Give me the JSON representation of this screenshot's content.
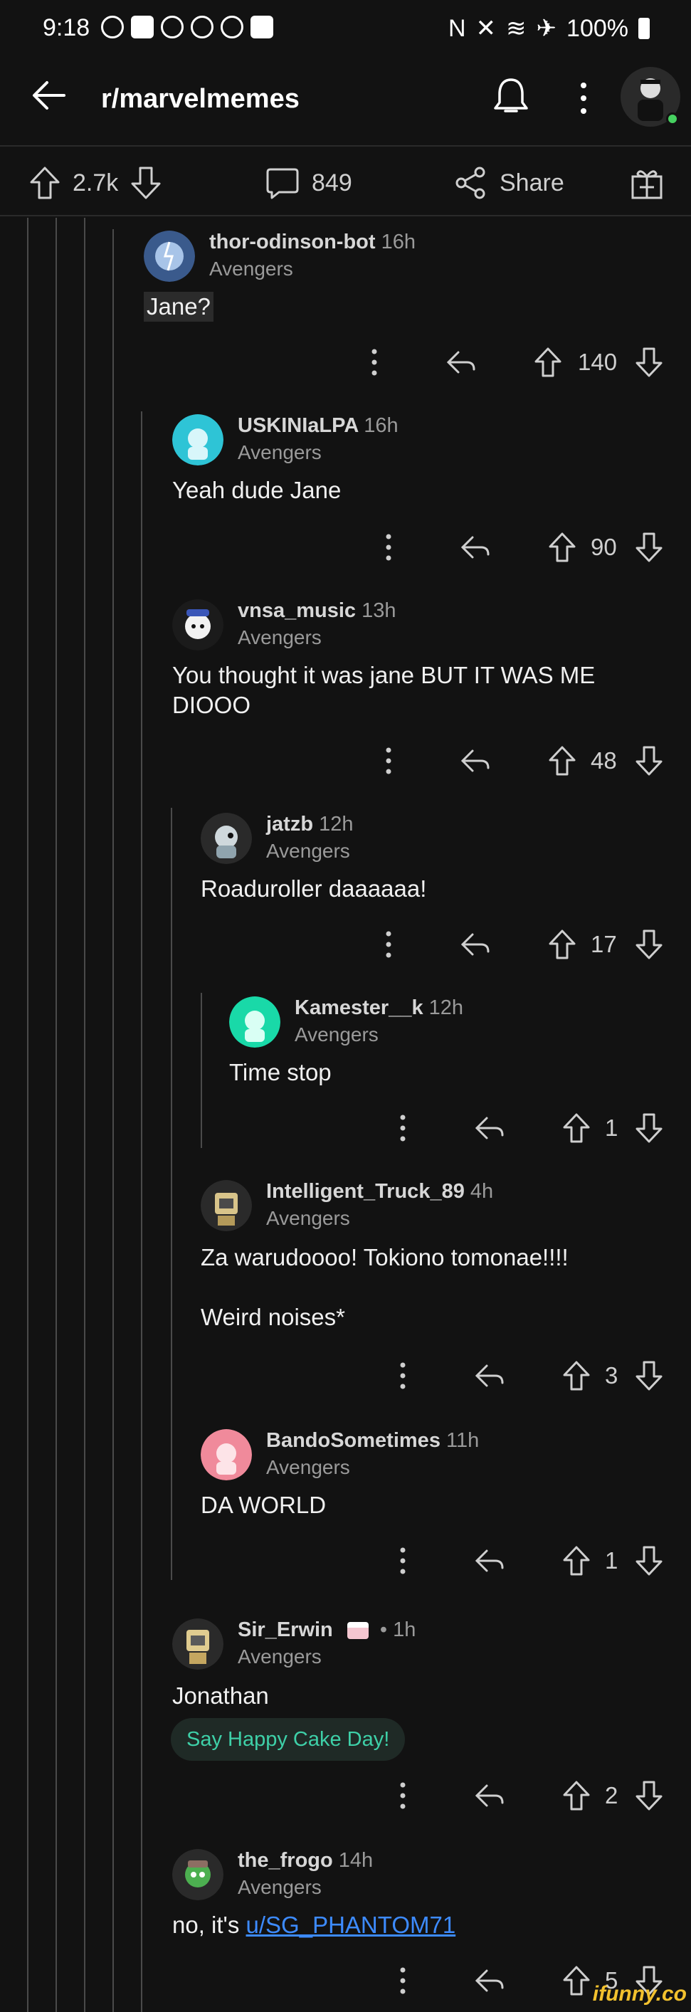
{
  "status_bar": {
    "time": "9:18",
    "battery": "100%"
  },
  "app_bar": {
    "title": "r/marvelmemes"
  },
  "post_actions": {
    "votes": "2.7k",
    "comments": "849",
    "share_label": "Share"
  },
  "comments": [
    {
      "user": "thor-odinson-bot",
      "age": "16h",
      "flair": "Avengers",
      "body": "Jane?",
      "votes": "140"
    },
    {
      "user": "USKINIaLPA",
      "age": "16h",
      "flair": "Avengers",
      "body": "Yeah dude Jane",
      "votes": "90"
    },
    {
      "user": "vnsa_music",
      "age": "13h",
      "flair": "Avengers",
      "body": "You thought it was jane BUT IT WAS ME\nDIOOO",
      "votes": "48"
    },
    {
      "user": "jatzb",
      "age": "12h",
      "flair": "Avengers",
      "body": "Roaduroller daaaaaa!",
      "votes": "17"
    },
    {
      "user": "Kamester__k",
      "age": "12h",
      "flair": "Avengers",
      "body": "Time stop",
      "votes": "1"
    },
    {
      "user": "Intelligent_Truck_89",
      "age": "4h",
      "flair": "Avengers",
      "body": "Za warudoooo! Tokiono tomonae!!!!\n\nWeird noises*",
      "votes": "3"
    },
    {
      "user": "BandoSometimes",
      "age": "11h",
      "flair": "Avengers",
      "body": "DA WORLD",
      "votes": "1"
    },
    {
      "user": "Sir_Erwin",
      "age": "• 1h",
      "flair": "Avengers",
      "body": "Jonathan",
      "votes": "2",
      "cake_day_label": "Say Happy Cake Day!"
    },
    {
      "user": "the_frogo",
      "age": "14h",
      "flair": "Avengers",
      "body_prefix": "no, it's ",
      "body_link": "u/SG_PHANTOM71",
      "votes": "5"
    }
  ],
  "watermark": "ifunny.co",
  "colors": {
    "background": "#121212",
    "link": "#3d8bff",
    "cake_day": "#3ed0a8",
    "online": "#46d160"
  }
}
